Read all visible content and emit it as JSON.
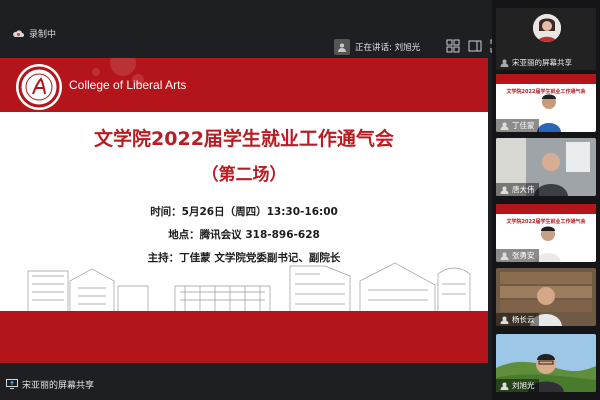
{
  "recording": {
    "label": "录制中"
  },
  "speaking": {
    "label": "正在讲话: 刘旭光"
  },
  "slide": {
    "college_name": "College of Liberal Arts",
    "title": "文学院2022届学生就业工作通气会",
    "subtitle": "（第二场）",
    "time_line": "时间：5月26日（周四）13:30-16:00",
    "place_line": "地点：腾讯会议 318-896-628",
    "host_line": "主持：丁佳蒙 文学院党委副书记、副院长"
  },
  "bottom_bar": {
    "label": "宋亚丽的屏幕共享"
  },
  "participants": [
    {
      "name": "宋亚丽的屏幕共享"
    },
    {
      "name": "丁佳蒙"
    },
    {
      "name": "唐大伟"
    },
    {
      "name": "张勇安"
    },
    {
      "name": "杨长云"
    },
    {
      "name": "刘旭光"
    }
  ],
  "mini_slide_title": "文学院2022届学生就业工作通气会",
  "colors": {
    "brand_red": "#b3151b",
    "title_red": "#b81d23",
    "bg": "#1e1f22"
  }
}
